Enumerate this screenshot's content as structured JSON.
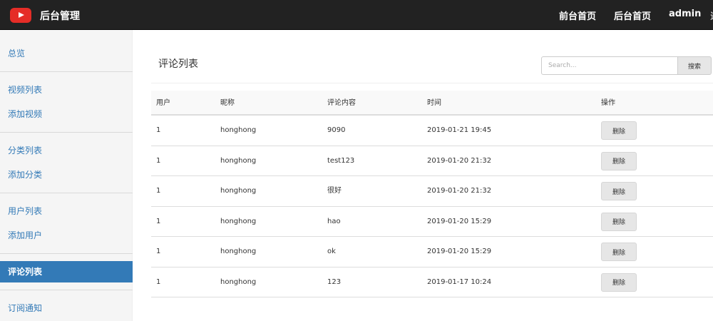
{
  "header": {
    "brand": "后台管理",
    "logo_icon": "youtube-play-icon",
    "nav": [
      "前台首页",
      "后台首页",
      "admin"
    ]
  },
  "sidebar": {
    "groups": [
      [
        "总览"
      ],
      [
        "视频列表",
        "添加视频"
      ],
      [
        "分类列表",
        "添加分类"
      ],
      [
        "用户列表",
        "添加用户"
      ],
      [
        "评论列表"
      ],
      [
        "订阅通知"
      ]
    ],
    "active": "评论列表",
    "accent": "#337ab7"
  },
  "main": {
    "title": "评论列表",
    "search": {
      "placeholder": "Search...",
      "button": "搜索"
    },
    "table": {
      "columns": [
        "用户",
        "昵称",
        "评论内容",
        "时间",
        "操作"
      ],
      "rows": [
        [
          "1",
          "honghong",
          "9090",
          "2019-01-21 19:45",
          "删除"
        ],
        [
          "1",
          "honghong",
          "test123",
          "2019-01-20 21:32",
          "删除"
        ],
        [
          "1",
          "honghong",
          "很好",
          "2019-01-20 21:32",
          "删除"
        ],
        [
          "1",
          "honghong",
          "hao",
          "2019-01-20 15:29",
          "删除"
        ],
        [
          "1",
          "honghong",
          "ok",
          "2019-01-20 15:29",
          "删除"
        ],
        [
          "1",
          "honghong",
          "123",
          "2019-01-17 10:24",
          "删除"
        ]
      ]
    }
  }
}
